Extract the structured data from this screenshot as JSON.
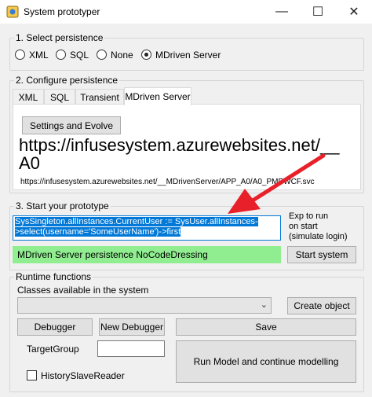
{
  "window": {
    "title": "System prototyper"
  },
  "section1": {
    "legend": "1. Select persistence",
    "options": [
      "XML",
      "SQL",
      "None",
      "MDriven Server"
    ],
    "selected_index": 3
  },
  "section2": {
    "legend": "2. Configure persistence",
    "tabs": [
      "XML",
      "SQL",
      "Transient",
      "MDriven Server"
    ],
    "active_tab_index": 3,
    "settings_button": "Settings and Evolve",
    "big_url_line1": "https://infusesystem.azurewebsites.net/__",
    "big_url_line2": "A0",
    "small_url": "https://infusesystem.azurewebsites.net/__MDrivenServer/APP_A0/A0_PMPWCF.svc"
  },
  "section3": {
    "legend": "3. Start your prototype",
    "expression": "SysSingleton.allInstances.CurrentUser := SysUser.allInstances->select(username='SomeUserName')->first",
    "exp_label_line1": "Exp to run",
    "exp_label_line2": "on start",
    "exp_label_line3": "(simulate login)",
    "status_text": "MDriven Server persistence NoCodeDressing",
    "start_button": "Start system"
  },
  "runtime": {
    "legend": "Runtime functions",
    "classes_label": "Classes available in the system",
    "classes_value": "",
    "create_object_button": "Create object",
    "debugger_button": "Debugger",
    "new_debugger_button": "New Debugger",
    "save_button": "Save",
    "target_group_label": "TargetGroup",
    "target_group_value": "",
    "run_model_button": "Run Model and continue modelling",
    "history_checkbox_label": "HistorySlaveReader",
    "history_checked": false
  },
  "colors": {
    "status_bg": "#90ee90",
    "selection": "#0078d7",
    "arrow": "#e8202a"
  }
}
